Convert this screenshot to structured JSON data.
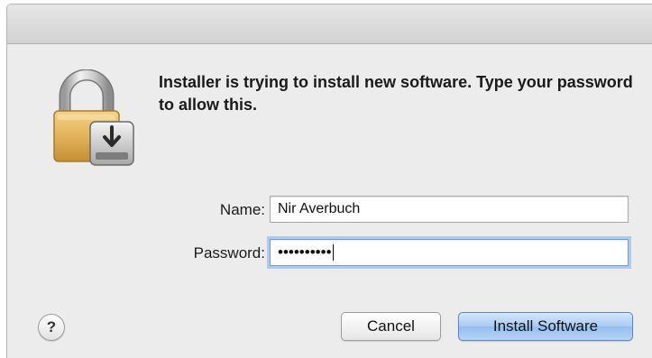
{
  "dialog": {
    "message": "Installer is trying to install new software. Type your password to allow this.",
    "name_label": "Name:",
    "name_value": "Nir Averbuch",
    "password_label": "Password:",
    "password_value": "••••••••••",
    "help_label": "?",
    "cancel_label": "Cancel",
    "install_label": "Install Software"
  },
  "icons": {
    "app_icon": "padlock-installer-icon"
  },
  "colors": {
    "window_bg": "#ececec",
    "default_button": "#a9cbf3",
    "focus_ring": "#6f9bd9"
  }
}
